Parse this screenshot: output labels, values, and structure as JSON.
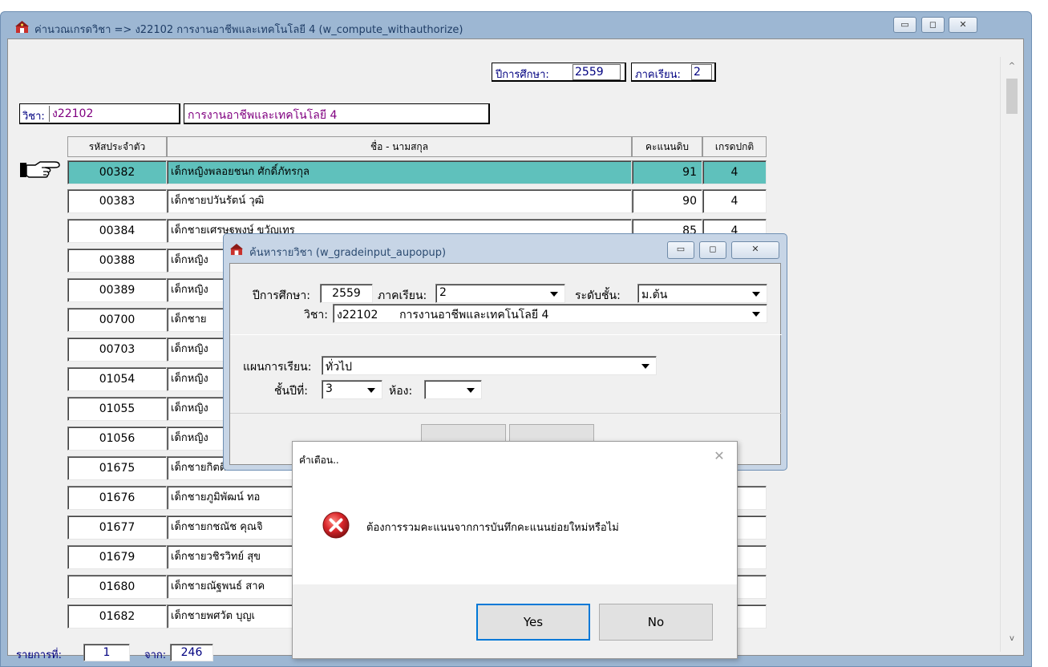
{
  "main_window": {
    "title": "ค่านวณเกรดวิชา => ง22102 การงานอาชีพและเทคโนโลยี 4  (w_compute_withauthorize)"
  },
  "header": {
    "year_label": "ปีการศึกษา:",
    "year_value": "2559",
    "term_label": "ภาคเรียน:",
    "term_value": "2",
    "subject_label": "วิชา:",
    "subject_code": "ง22102",
    "subject_name": "การงานอาชีพและเทคโนโลยี 4"
  },
  "grid": {
    "columns": [
      "รหัสประจำตัว",
      "ชื่อ - นามสกุล",
      "คะแนนดิบ",
      "เกรดปกติ"
    ],
    "rows": [
      {
        "id": "00382",
        "name": "เด็กหญิงพลอยชนก ศักดิ์ภัทรกุล",
        "score": "91",
        "grade": "4"
      },
      {
        "id": "00383",
        "name": "เด็กชายปวันรัตน์ วุฒิ",
        "score": "90",
        "grade": "4"
      },
      {
        "id": "00384",
        "name": "เด็กชายเศรษฐพงษ์ ขวัญเทร",
        "score": "85",
        "grade": "4"
      },
      {
        "id": "00388",
        "name": "เด็กหญิง",
        "score": "",
        "grade": ""
      },
      {
        "id": "00389",
        "name": "เด็กหญิง",
        "score": "",
        "grade": ""
      },
      {
        "id": "00700",
        "name": "เด็กชาย",
        "score": "",
        "grade": ""
      },
      {
        "id": "00703",
        "name": "เด็กหญิง",
        "score": "",
        "grade": ""
      },
      {
        "id": "01054",
        "name": "เด็กหญิง",
        "score": "",
        "grade": ""
      },
      {
        "id": "01055",
        "name": "เด็กหญิง",
        "score": "",
        "grade": ""
      },
      {
        "id": "01056",
        "name": "เด็กหญิง",
        "score": "",
        "grade": ""
      },
      {
        "id": "01675",
        "name": "เด็กชายกิตติพัฒน์ ช",
        "score": "",
        "grade": ""
      },
      {
        "id": "01676",
        "name": "เด็กชายภูมิพัฒน์ ทอ",
        "score": "",
        "grade": ""
      },
      {
        "id": "01677",
        "name": "เด็กชายกชณัช คุณจิ",
        "score": "",
        "grade": ""
      },
      {
        "id": "01679",
        "name": "เด็กชายวชิรวิทย์ สุข",
        "score": "",
        "grade": ""
      },
      {
        "id": "01680",
        "name": "เด็กชายณัฐพนธ์ สาค",
        "score": "",
        "grade": ""
      },
      {
        "id": "01682",
        "name": "เด็กชายพศวัต บุญเ",
        "score": "",
        "grade": ""
      }
    ]
  },
  "footer": {
    "record_label": "รายการที่:",
    "record_value": "1",
    "of_label": "จาก:",
    "total_value": "246"
  },
  "popup": {
    "title": "ค้นหารายวิชา (w_gradeinput_aupopup)",
    "year_label": "ปีการศึกษา:",
    "year_value": "2559",
    "term_label": "ภาคเรียน:",
    "term_value": "2",
    "level_label": "ระดับชั้น:",
    "level_value": "ม.ต้น",
    "subject_label": "วิชา:",
    "subject_value": "ง22102      การงานอาชีพและเทคโนโลยี 4",
    "plan_label": "แผนการเรียน:",
    "plan_value": "ทั่วไป",
    "grade_label": "ชั้นปีที่:",
    "grade_value": "3",
    "room_label": "ห้อง:",
    "room_value": ""
  },
  "dialog": {
    "title": "คำเตือน..",
    "message": "ต้องการรวมคะแนนจากการบันทึกคะแนนย่อยใหม่หรือไม่",
    "yes_label": "Yes",
    "no_label": "No"
  },
  "colors": {
    "selected_row": "#5fc1bc",
    "title_text": "#1f3d66",
    "error_icon": "#d9262b"
  },
  "icons": [
    "app-icon",
    "pointing-hand-icon",
    "error-icon",
    "minimize-icon",
    "maximize-icon",
    "close-icon",
    "dropdown-arrow-icon",
    "scroll-up-icon",
    "scroll-down-icon"
  ]
}
